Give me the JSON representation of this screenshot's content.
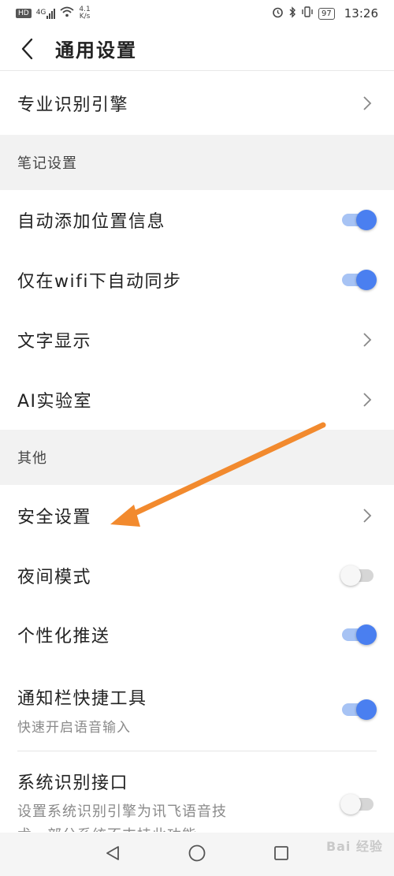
{
  "status_bar": {
    "hd": "HD",
    "signal": "4G",
    "speed_value": "4.1",
    "speed_unit": "K/s",
    "battery": "97",
    "time": "13:26"
  },
  "header": {
    "back_icon": "chevron-left-icon",
    "title": "通用设置"
  },
  "rows": {
    "engine": {
      "label": "专业识别引擎"
    },
    "note_section": "笔记设置",
    "auto_location": {
      "label": "自动添加位置信息",
      "on": true
    },
    "wifi_sync": {
      "label": "仅在wifi下自动同步",
      "on": true
    },
    "text_display": {
      "label": "文字显示"
    },
    "ai_lab": {
      "label": "AI实验室"
    },
    "other_section": "其他",
    "security": {
      "label": "安全设置"
    },
    "night_mode": {
      "label": "夜间模式",
      "on": false
    },
    "push": {
      "label": "个性化推送",
      "on": true
    },
    "notif_tool": {
      "label": "通知栏快捷工具",
      "sub": "快速开启语音输入",
      "on": true
    },
    "sys_engine": {
      "label": "系统识别接口",
      "sub_line1": "设置系统识别引擎为讯飞语音技",
      "sub_line2": "术，部分系统不支持此功能",
      "on": false
    }
  },
  "watermark": "Bai 经验",
  "colors": {
    "toggle_on": "#4a7ff0",
    "toggle_on_track": "#a7c3f4",
    "arrow": "#f28a2e",
    "section_bg": "#f2f2f2"
  }
}
